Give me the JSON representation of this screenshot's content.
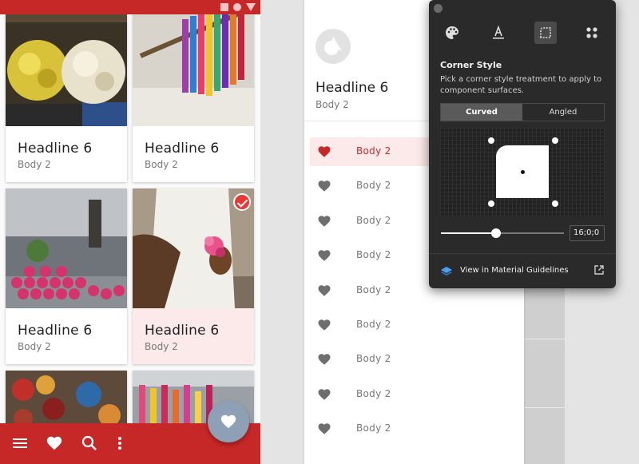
{
  "phone": {
    "cards": [
      {
        "headline": "Headline 6",
        "body": "Body 2",
        "selected": false
      },
      {
        "headline": "Headline 6",
        "body": "Body 2",
        "selected": false
      },
      {
        "headline": "Headline 6",
        "body": "Body 2",
        "selected": false
      },
      {
        "headline": "Headline 6",
        "body": "Body 2",
        "selected": true
      }
    ],
    "bottom_bar_icons": [
      "menu-icon",
      "heart-icon",
      "search-icon",
      "more-vert-icon"
    ],
    "fab_icon": "heart-icon",
    "colors": {
      "primary": "#c62828",
      "fab": "#8ea0b5",
      "selected_bg": "#fce9e9"
    }
  },
  "list_panel": {
    "headline": "Headline 6",
    "body": "Body 2",
    "items": [
      {
        "label": "Body 2",
        "active": true
      },
      {
        "label": "Body 2",
        "active": false
      },
      {
        "label": "Body 2",
        "active": false
      },
      {
        "label": "Body 2",
        "active": false
      },
      {
        "label": "Body 2",
        "active": false
      },
      {
        "label": "Body 2",
        "active": false
      },
      {
        "label": "Body 2",
        "active": false
      },
      {
        "label": "Body 2",
        "active": false
      },
      {
        "label": "Body 2",
        "active": false
      }
    ]
  },
  "popover": {
    "tools": [
      "palette-icon",
      "typography-icon",
      "shape-icon",
      "icons-icon"
    ],
    "active_tool": "shape-icon",
    "title": "Corner Style",
    "description": "Pick a corner style treatment to apply to component surfaces.",
    "segments": [
      "Curved",
      "Angled"
    ],
    "selected_segment": "Curved",
    "slider_value": "16;0;0",
    "slider_fraction": 0.45,
    "guidelines_label": "View in Material Guidelines"
  }
}
